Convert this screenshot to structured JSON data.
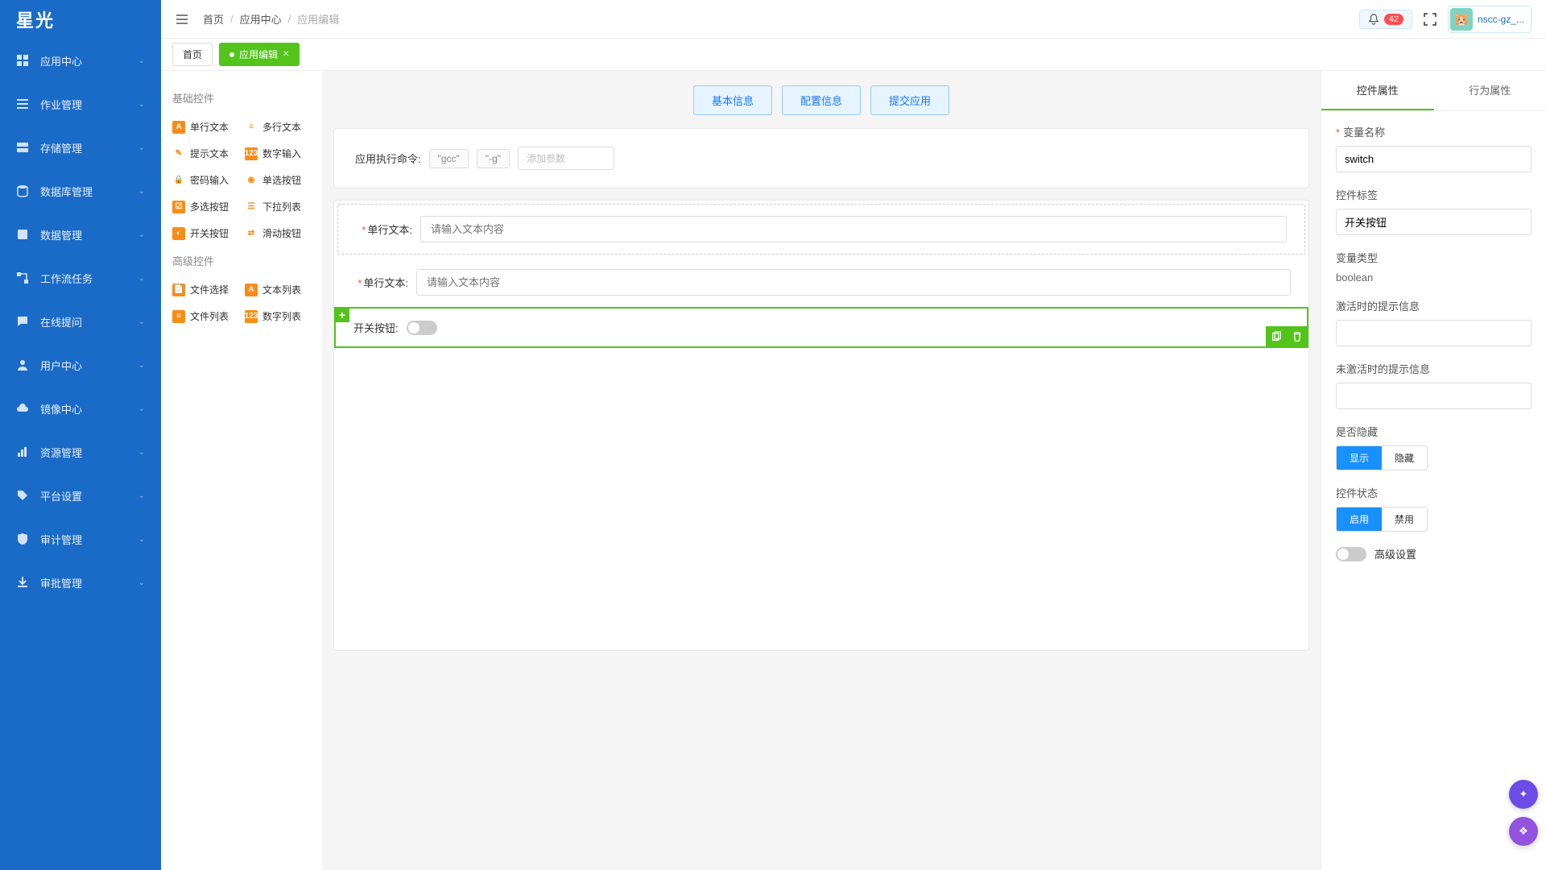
{
  "logo": "星光",
  "sidebar": {
    "items": [
      {
        "label": "应用中心"
      },
      {
        "label": "作业管理"
      },
      {
        "label": "存储管理"
      },
      {
        "label": "数据库管理"
      },
      {
        "label": "数据管理"
      },
      {
        "label": "工作流任务"
      },
      {
        "label": "在线提问"
      },
      {
        "label": "用户中心"
      },
      {
        "label": "镜像中心"
      },
      {
        "label": "资源管理"
      },
      {
        "label": "平台设置"
      },
      {
        "label": "审计管理"
      },
      {
        "label": "审批管理"
      }
    ]
  },
  "breadcrumb": {
    "home": "首页",
    "mid": "应用中心",
    "cur": "应用编辑"
  },
  "header": {
    "badge": "42",
    "username": "nscc-gz_..."
  },
  "tabs": {
    "home": "首页",
    "active": "应用编辑"
  },
  "palette": {
    "basic_title": "基础控件",
    "basic": [
      {
        "label": "单行文本"
      },
      {
        "label": "多行文本"
      },
      {
        "label": "提示文本"
      },
      {
        "label": "数字输入"
      },
      {
        "label": "密码输入"
      },
      {
        "label": "单选按钮"
      },
      {
        "label": "多选按钮"
      },
      {
        "label": "下拉列表"
      },
      {
        "label": "开关按钮"
      },
      {
        "label": "滑动按钮"
      }
    ],
    "adv_title": "高级控件",
    "adv": [
      {
        "label": "文件选择"
      },
      {
        "label": "文本列表"
      },
      {
        "label": "文件列表"
      },
      {
        "label": "数字列表"
      }
    ]
  },
  "steps": {
    "s1": "基本信息",
    "s2": "配置信息",
    "s3": "提交应用"
  },
  "cmd": {
    "label": "应用执行命令:",
    "chip1": "\"gcc\"",
    "chip2": "\"-g\"",
    "placeholder": "添加参数"
  },
  "form": {
    "row1_label": "单行文本:",
    "row1_ph": "请输入文本内容",
    "row2_label": "单行文本:",
    "row2_ph": "请输入文本内容",
    "row3_label": "开关按钮:"
  },
  "props": {
    "tab1": "控件属性",
    "tab2": "行为属性",
    "var_name_label": "变量名称",
    "var_name_value": "switch",
    "ctrl_label_label": "控件标签",
    "ctrl_label_value": "开关按钮",
    "var_type_label": "变量类型",
    "var_type_value": "boolean",
    "active_hint_label": "激活时的提示信息",
    "inactive_hint_label": "未激活时的提示信息",
    "hidden_label": "是否隐藏",
    "hidden_show": "显示",
    "hidden_hide": "隐藏",
    "state_label": "控件状态",
    "state_on": "启用",
    "state_off": "禁用",
    "adv_label": "高级设置"
  }
}
